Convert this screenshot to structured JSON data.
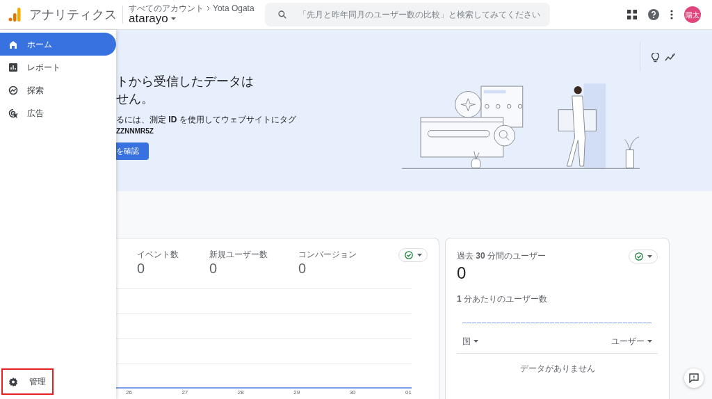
{
  "header": {
    "app_title": "アナリティクス",
    "breadcrumb": "すべてのアカウント",
    "breadcrumb_account": "Yota Ogata",
    "property": "atarayo",
    "search": {
      "placeholder": "「先月と昨年同月のユーザー数の比較」と検索してみてください"
    },
    "avatar": "陽太"
  },
  "sidebar": {
    "items": [
      {
        "label": "ホーム",
        "selected": true
      },
      {
        "label": "レポート",
        "selected": false
      },
      {
        "label": "探索",
        "selected": false
      },
      {
        "label": "広告",
        "selected": false
      }
    ],
    "footer": {
      "label": "管理",
      "highlighted": true
    }
  },
  "banner": {
    "title_lines": [
      "トから受信したデータは",
      "せん。"
    ],
    "body": "るには、測定 **ID** を使用してウェブサイトにタグ",
    "measurement_id": "ZZNNMR5Z",
    "button": "を確認"
  },
  "overview_card": {
    "metrics": [
      {
        "label": "イベント数",
        "value": "0"
      },
      {
        "label": "新規ユーザー数",
        "value": "0"
      },
      {
        "label": "コンバージョン",
        "value": "0"
      }
    ],
    "status_ok": true,
    "x_labels": [
      "26",
      "27",
      "28",
      "29",
      "30",
      "01"
    ]
  },
  "realtime_card": {
    "title": "過去 **30** 分間のユーザー",
    "value": "0",
    "subtitle": "**1** 分あたりのユーザー数",
    "status_ok": true,
    "columns": [
      "国",
      "ユーザー"
    ],
    "empty_message": "データがありません"
  }
}
